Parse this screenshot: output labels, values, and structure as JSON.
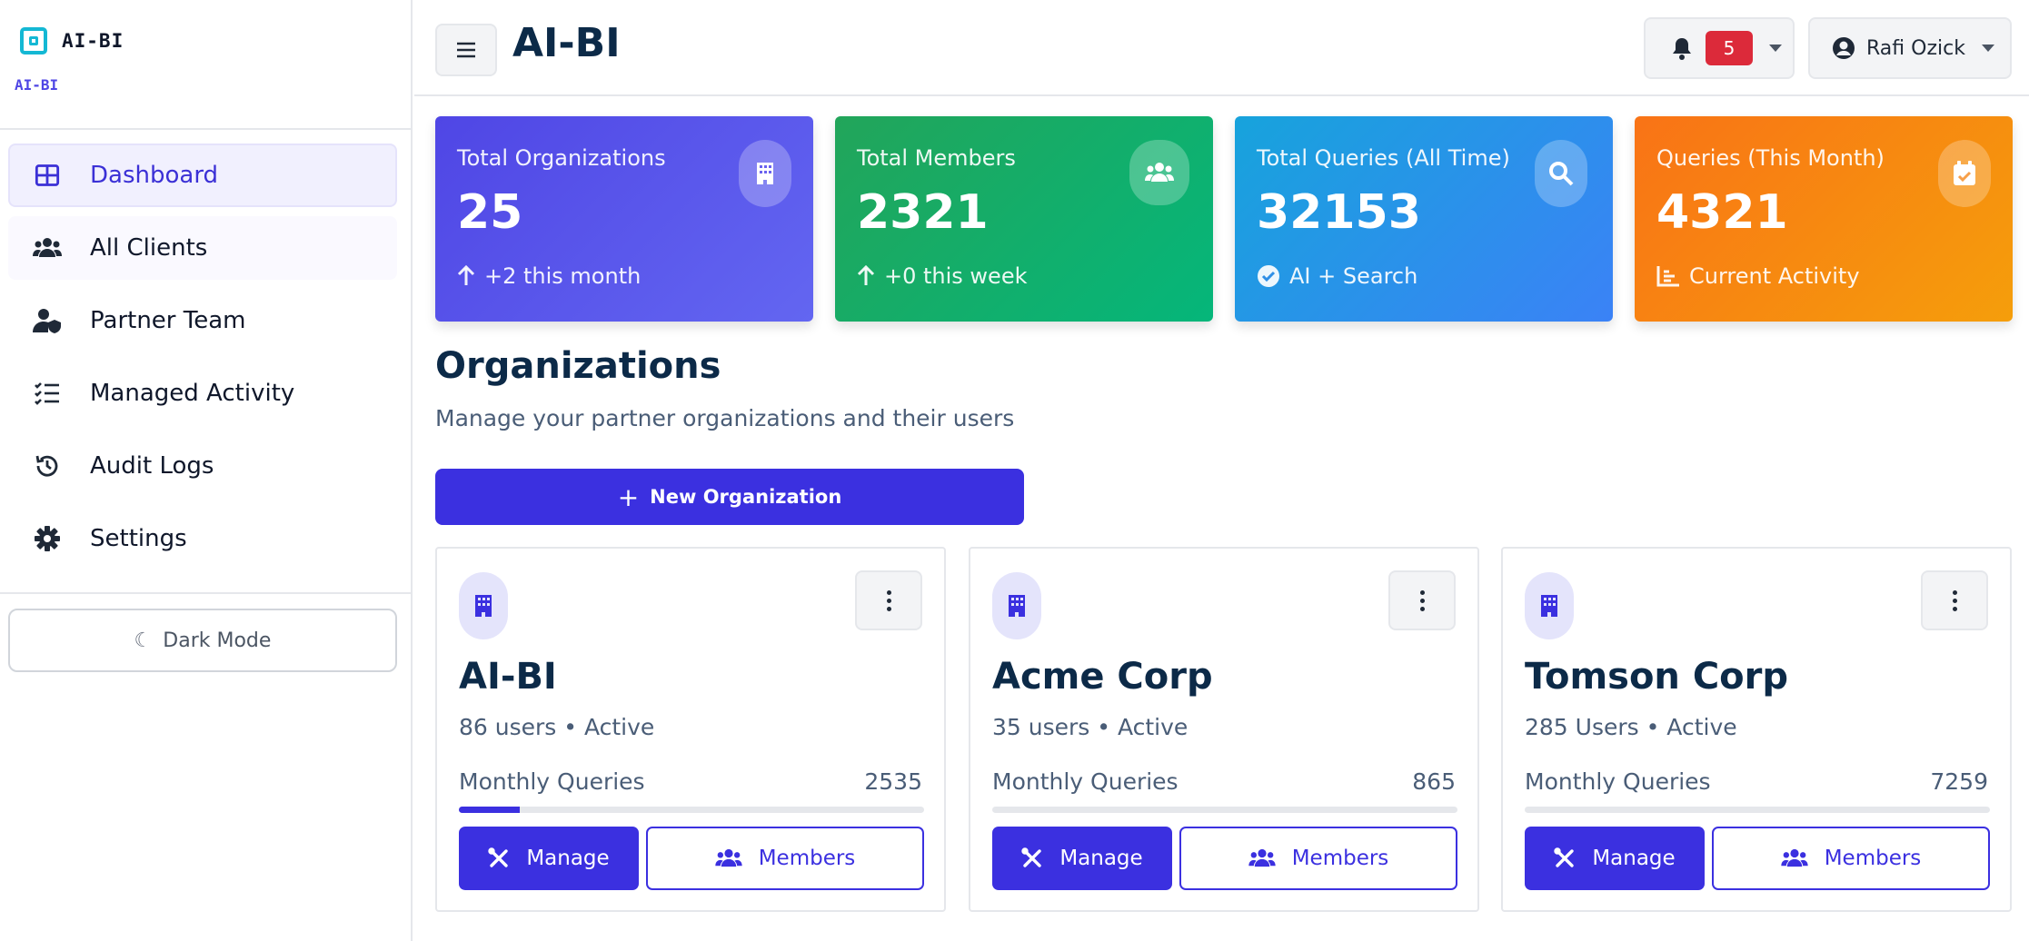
{
  "brand": {
    "name": "AI-BI",
    "subtitle": "AI-BI"
  },
  "sidebar": {
    "items": [
      {
        "label": "Dashboard",
        "icon": "grid-icon"
      },
      {
        "label": "All Clients",
        "icon": "users-icon"
      },
      {
        "label": "Partner Team",
        "icon": "user-shield-icon"
      },
      {
        "label": "Managed Activity",
        "icon": "list-check-icon"
      },
      {
        "label": "Audit Logs",
        "icon": "history-icon"
      },
      {
        "label": "Settings",
        "icon": "gear-icon"
      }
    ],
    "dark_mode_label": "Dark Mode"
  },
  "header": {
    "title": "AI-BI",
    "notifications_count": "5",
    "user_name": "Rafi Ozick"
  },
  "stats": [
    {
      "title": "Total Organizations",
      "value": "25",
      "footer": "+2 this month",
      "icon": "building-icon",
      "footer_icon": "arrow-up-icon"
    },
    {
      "title": "Total Members",
      "value": "2321",
      "footer": "+0 this week",
      "icon": "users-icon",
      "footer_icon": "arrow-up-icon"
    },
    {
      "title": "Total Queries (All Time)",
      "value": "32153",
      "footer": "AI + Search",
      "icon": "search-icon",
      "footer_icon": "check-circle-icon"
    },
    {
      "title": "Queries (This Month)",
      "value": "4321",
      "footer": "Current Activity",
      "icon": "calendar-check-icon",
      "footer_icon": "chart-bar-icon"
    }
  ],
  "organizations": {
    "title": "Organizations",
    "subtitle": "Manage your partner organizations and their users",
    "new_button": "New Organization",
    "queries_label": "Monthly Queries",
    "manage_label": "Manage",
    "members_label": "Members",
    "cards": [
      {
        "name": "AI-BI",
        "meta": "86 users • Active",
        "queries": "2535",
        "progress": 0.13
      },
      {
        "name": "Acme Corp",
        "meta": "35 users • Active",
        "queries": "865",
        "progress": 0.0
      },
      {
        "name": "Tomson Corp",
        "meta": "285 Users • Active",
        "queries": "7259",
        "progress": 0.0
      }
    ]
  },
  "colors": {
    "primary": "#3b30e0",
    "accent_cyan": "#14b8d4",
    "badge_red": "#dc2a3a",
    "heading": "#0c2a48"
  }
}
